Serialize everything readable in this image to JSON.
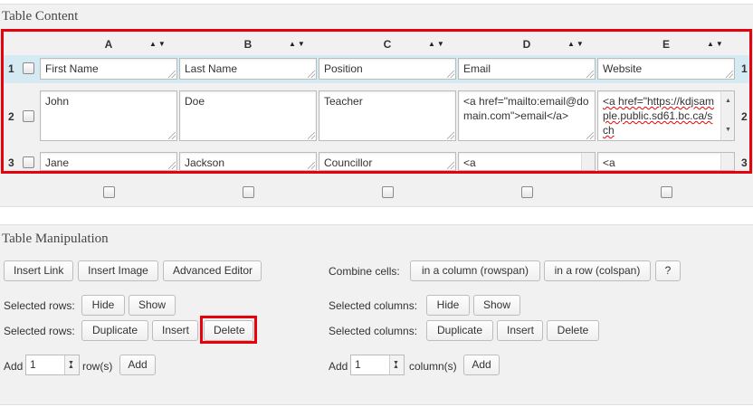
{
  "table_content": {
    "title": "Table Content",
    "columns": [
      "A",
      "B",
      "C",
      "D",
      "E"
    ],
    "sort_glyph": "▲▼",
    "rows": [
      {
        "num": "1",
        "cells": [
          "First Name",
          "Last Name",
          "Position",
          "Email",
          "Website"
        ]
      },
      {
        "num": "2",
        "cells": [
          "John",
          "Doe",
          "Teacher",
          "<a href=\"mailto:email@domain.com\">email</a>",
          "<a href=\"https://kdjsample.public.sd61.bc.ca/sch"
        ]
      },
      {
        "num": "3",
        "cells": [
          "Jane",
          "Jackson",
          "Councillor",
          "<a",
          "<a"
        ]
      }
    ]
  },
  "table_manipulation": {
    "title": "Table Manipulation",
    "insert_link": "Insert Link",
    "insert_image": "Insert Image",
    "advanced_editor": "Advanced Editor",
    "combine_cells_label": "Combine cells:",
    "in_column_rowspan": "in a column (rowspan)",
    "in_row_colspan": "in a row (colspan)",
    "help": "?",
    "selected_rows_label": "Selected rows:",
    "selected_columns_label": "Selected columns:",
    "hide": "Hide",
    "show": "Show",
    "duplicate": "Duplicate",
    "insert": "Insert",
    "delete": "Delete",
    "add_label": "Add",
    "add_rows_value": "1",
    "rows_suffix": "row(s)",
    "add_cols_value": "1",
    "cols_suffix": "column(s)",
    "add_button": "Add"
  }
}
